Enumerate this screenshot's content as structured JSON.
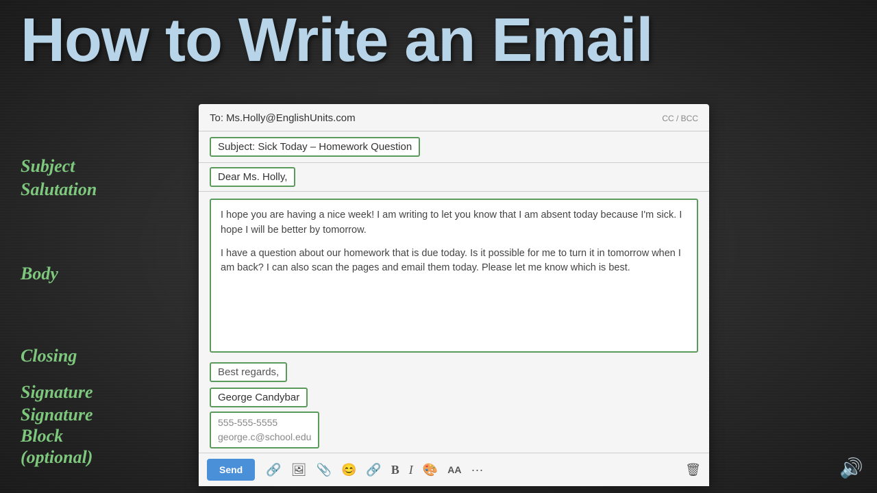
{
  "title": "How to Write an Email",
  "labels": {
    "subject": "Subject",
    "salutation": "Salutation",
    "body": "Body",
    "closing": "Closing",
    "signature": "Signature",
    "sig_block": "Signature\nBlock\n(optional)"
  },
  "email": {
    "to_label": "To:",
    "to_address": "Ms.Holly@EnglishUnits.com",
    "cc_bcc": "CC / BCC",
    "subject": "Subject:  Sick Today – Homework Question",
    "salutation": "Dear Ms. Holly,",
    "body_para1": "I hope you are having a nice week! I am writing to let you know that I am absent today because I'm sick. I hope I will be better by tomorrow.",
    "body_para2": "I have a question about our homework that is due today. Is it possible for me to turn it in tomorrow when I am back? I can also scan the pages and email them today. Please let me know which is best.",
    "closing": "Best regards,",
    "signature": "George Candybar",
    "sig_phone": "555-555-5555",
    "sig_email": "george.c@school.edu",
    "send_btn": "Send"
  },
  "toolbar": {
    "send": "Send",
    "icons": [
      "🔗",
      "🖼",
      "📎",
      "😊",
      "🔗",
      "B",
      "I",
      "🎨",
      "AA",
      "···"
    ]
  }
}
